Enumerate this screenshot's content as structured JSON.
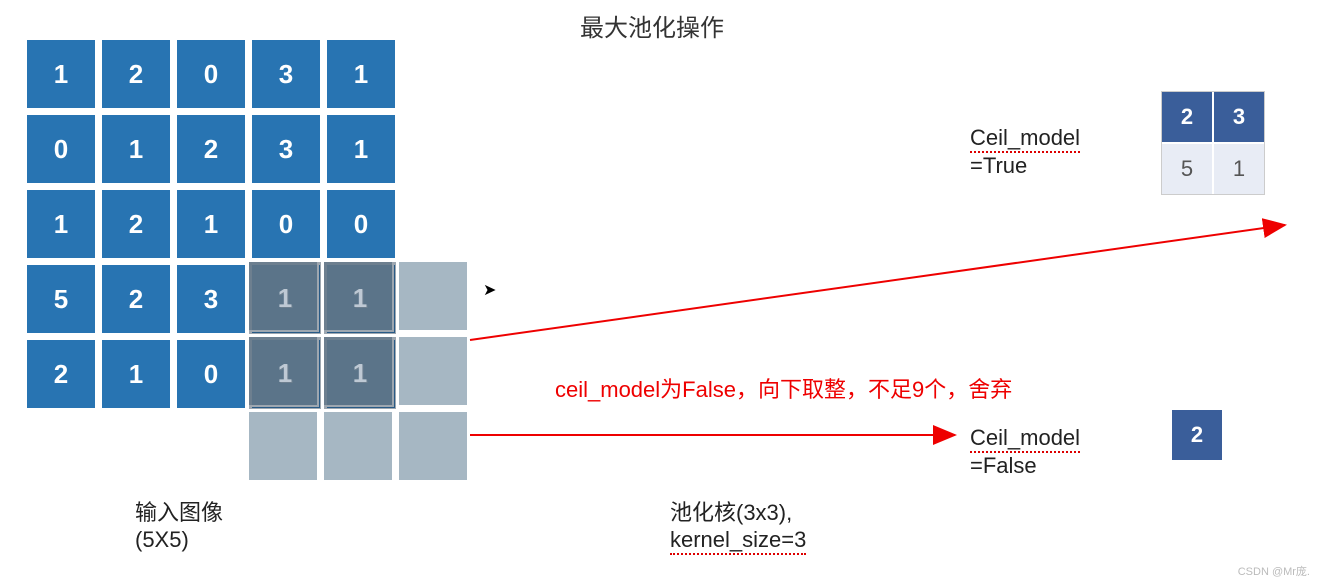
{
  "title": "最大池化操作",
  "input_grid": [
    [
      1,
      2,
      0,
      3,
      1
    ],
    [
      0,
      1,
      2,
      3,
      1
    ],
    [
      1,
      2,
      1,
      0,
      0
    ],
    [
      5,
      2,
      3,
      1,
      1
    ],
    [
      2,
      1,
      0,
      1,
      1
    ]
  ],
  "kernel_overlay_values": [
    1,
    1,
    1,
    1
  ],
  "input_label_line1": "输入图像",
  "input_label_line2": "(5X5)",
  "kernel_label_line1": "池化核(3x3),",
  "kernel_label_line2": "kernel_size=3",
  "ceil_true_label_line1": "Ceil_model",
  "ceil_true_label_line2": "=True",
  "ceil_false_label_line1": "Ceil_model",
  "ceil_false_label_line2": "=False",
  "red_annotation": "ceil_model为False，向下取整，不足9个，舍弃",
  "output_ceil_true": [
    [
      2,
      3
    ],
    [
      5,
      1
    ]
  ],
  "output_ceil_false": [
    [
      2
    ]
  ],
  "watermark": "CSDN @Mr庞.",
  "chart_data": {
    "type": "table",
    "title": "最大池化操作 (Max Pooling)",
    "input_size": "5x5",
    "kernel_size": 3,
    "stride": 3,
    "input": [
      [
        1,
        2,
        0,
        3,
        1
      ],
      [
        0,
        1,
        2,
        3,
        1
      ],
      [
        1,
        2,
        1,
        0,
        0
      ],
      [
        5,
        2,
        3,
        1,
        1
      ],
      [
        2,
        1,
        0,
        1,
        1
      ]
    ],
    "output_ceil_mode_true": [
      [
        2,
        3
      ],
      [
        5,
        1
      ]
    ],
    "output_ceil_mode_false": [
      [
        2
      ]
    ],
    "annotation": "ceil_model为False，向下取整，不足9个，舍弃"
  }
}
